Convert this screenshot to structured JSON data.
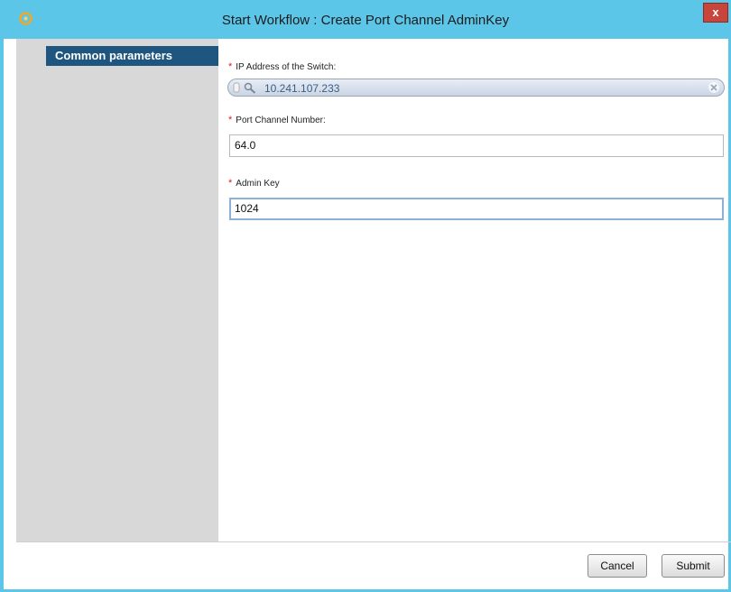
{
  "window": {
    "title": "Start Workflow : Create Port Channel AdminKey",
    "close_label": "x"
  },
  "sidebar": {
    "tabs": [
      {
        "label": "Common parameters"
      }
    ]
  },
  "form": {
    "required_mark": "*",
    "fields": [
      {
        "label": "IP Address of the Switch:",
        "value": "10.241.107.233"
      },
      {
        "label": "Port Channel Number:",
        "value": "64.0"
      },
      {
        "label": "Admin Key",
        "value": "1024"
      }
    ]
  },
  "footer": {
    "cancel_label": "Cancel",
    "submit_label": "Submit"
  },
  "colors": {
    "titlebar": "#5bc6e8",
    "sidebar": "#d8d8d8",
    "sidebar_tab": "#1e5680",
    "required": "#d0232b"
  }
}
